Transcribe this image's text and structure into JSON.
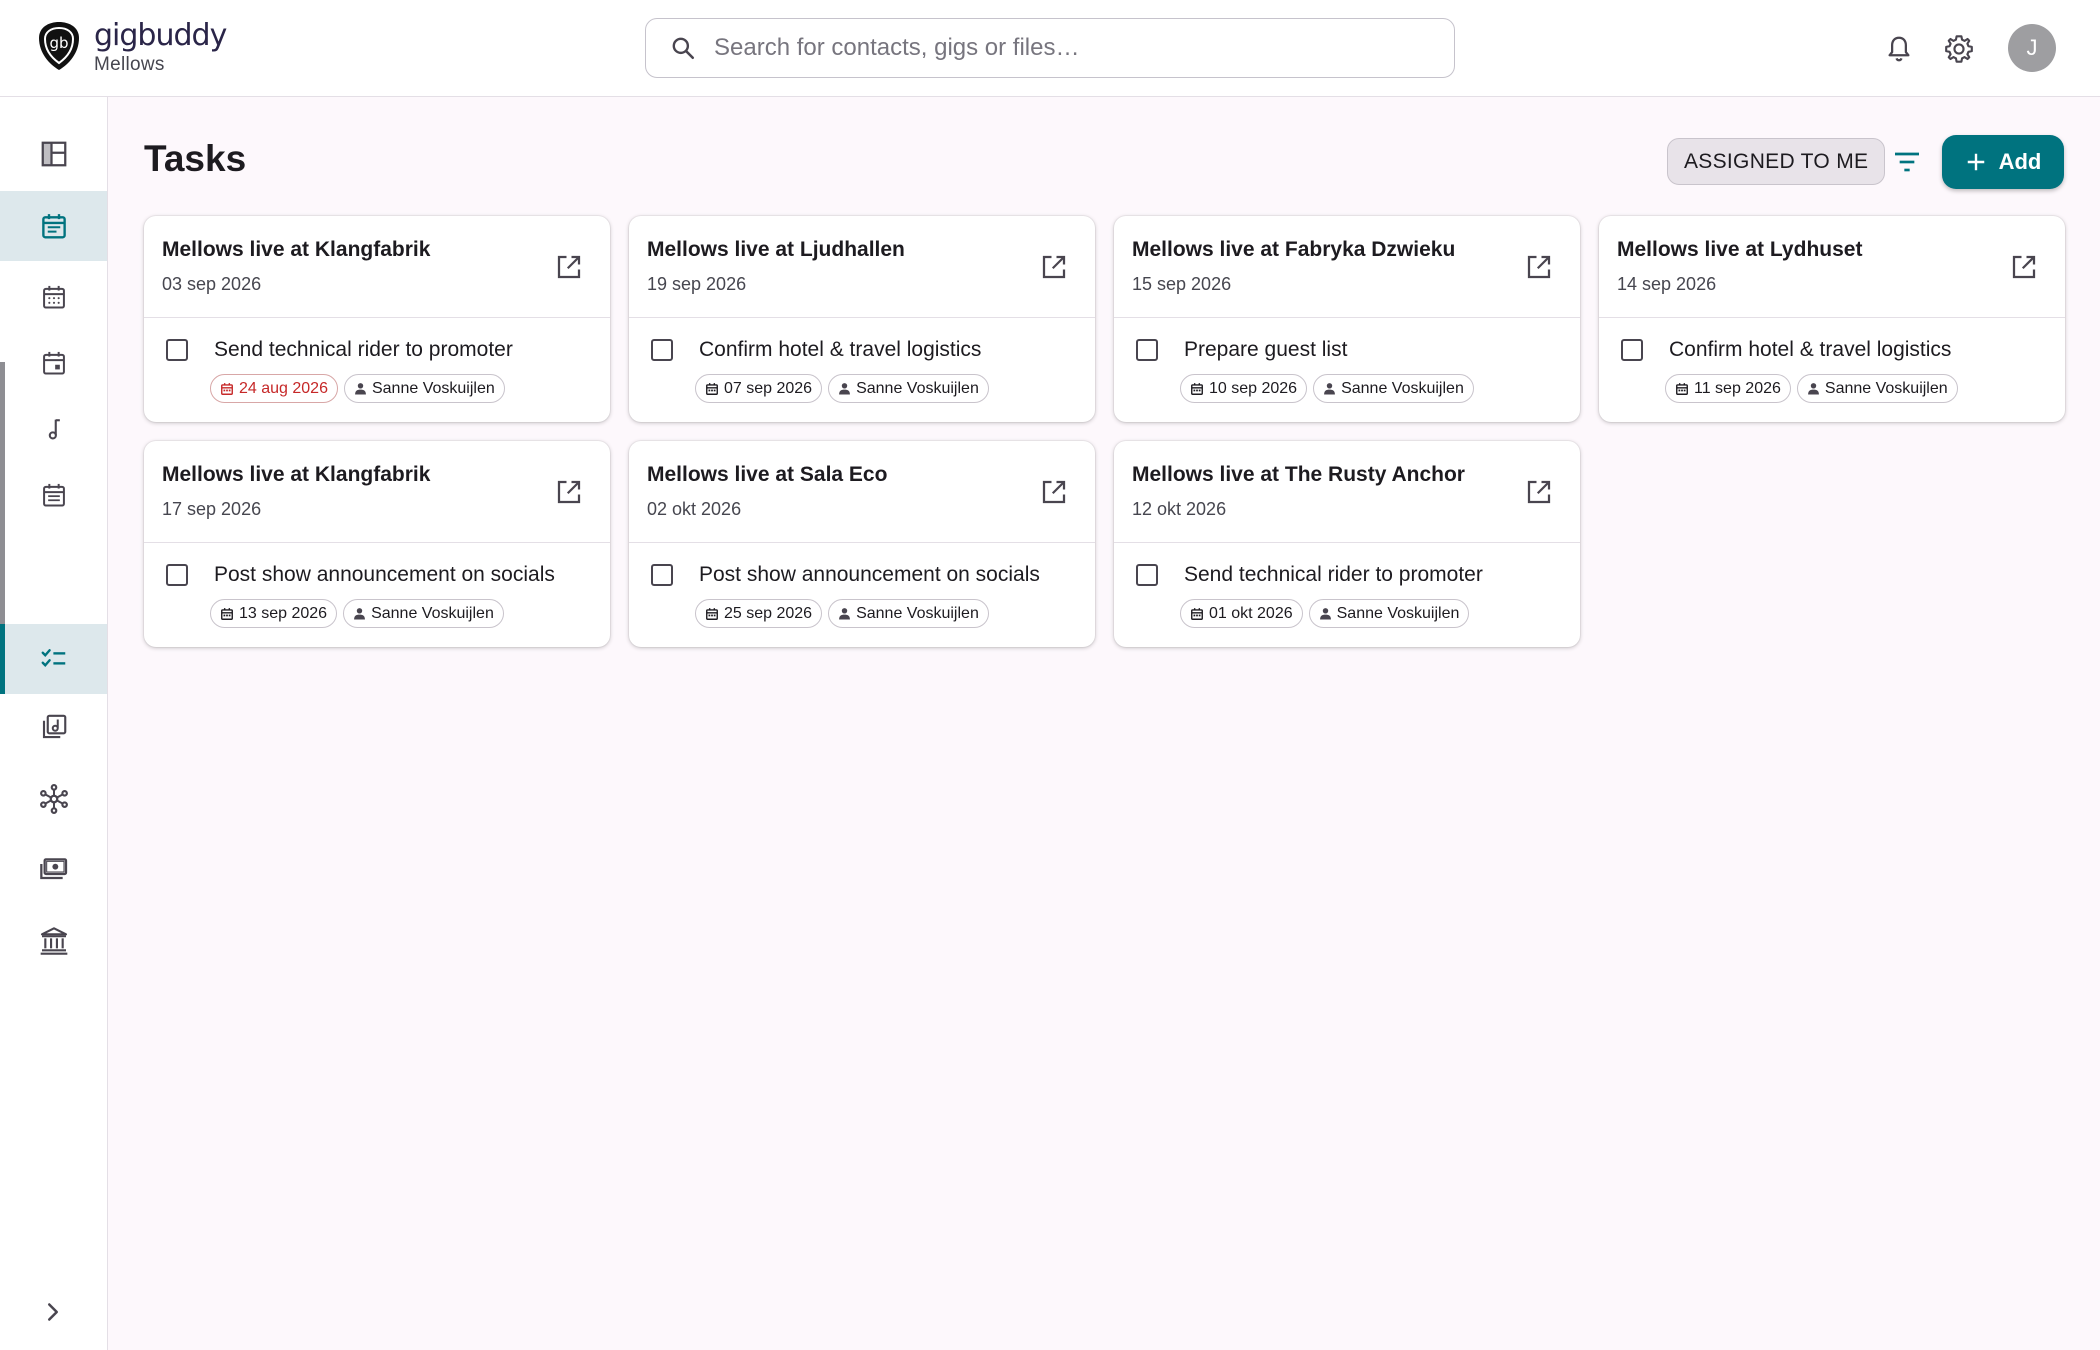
{
  "header": {
    "brand_name": "gigbuddy",
    "workspace": "Mellows",
    "search_placeholder": "Search for contacts, gigs or files…",
    "avatar_initial": "J"
  },
  "page": {
    "title": "Tasks",
    "assigned_filter_label": "ASSIGNED TO ME",
    "add_label": "Add"
  },
  "colors": {
    "accent": "#00737f",
    "overdue": "#c62828"
  },
  "sidebar": {
    "items": [
      {
        "icon": "dashboard-icon"
      },
      {
        "icon": "calendar-icon"
      },
      {
        "icon": "calendar-month-icon"
      },
      {
        "icon": "event-icon"
      },
      {
        "icon": "music-note-icon"
      },
      {
        "icon": "calendar-list-icon"
      },
      {
        "icon": "checklist-icon"
      },
      {
        "icon": "library-music-icon"
      },
      {
        "icon": "network-icon"
      },
      {
        "icon": "payments-icon"
      },
      {
        "icon": "bank-icon"
      }
    ]
  },
  "cards": [
    {
      "title": "Mellows live at Klangfabrik",
      "date": "03 sep 2026",
      "task": "Send technical rider to promoter",
      "due": "24 aug 2026",
      "overdue": true,
      "assignee": "Sanne Voskuijlen"
    },
    {
      "title": "Mellows live at Ljudhallen",
      "date": "19 sep 2026",
      "task": "Confirm hotel & travel logistics",
      "due": "07 sep 2026",
      "overdue": false,
      "assignee": "Sanne Voskuijlen"
    },
    {
      "title": "Mellows live at Fabryka Dzwieku",
      "date": "15 sep 2026",
      "task": "Prepare guest list",
      "due": "10 sep 2026",
      "overdue": false,
      "assignee": "Sanne Voskuijlen"
    },
    {
      "title": "Mellows live at Lydhuset",
      "date": "14 sep 2026",
      "task": "Confirm hotel & travel logistics",
      "due": "11 sep 2026",
      "overdue": false,
      "assignee": "Sanne Voskuijlen"
    },
    {
      "title": "Mellows live at Klangfabrik",
      "date": "17 sep 2026",
      "task": "Post show announcement on socials",
      "due": "13 sep 2026",
      "overdue": false,
      "assignee": "Sanne Voskuijlen"
    },
    {
      "title": "Mellows live at Sala Eco",
      "date": "02 okt 2026",
      "task": "Post show announcement on socials",
      "due": "25 sep 2026",
      "overdue": false,
      "assignee": "Sanne Voskuijlen"
    },
    {
      "title": "Mellows live at The Rusty Anchor",
      "date": "12 okt 2026",
      "task": "Send technical rider to promoter",
      "due": "01 okt 2026",
      "overdue": false,
      "assignee": "Sanne Voskuijlen"
    }
  ]
}
